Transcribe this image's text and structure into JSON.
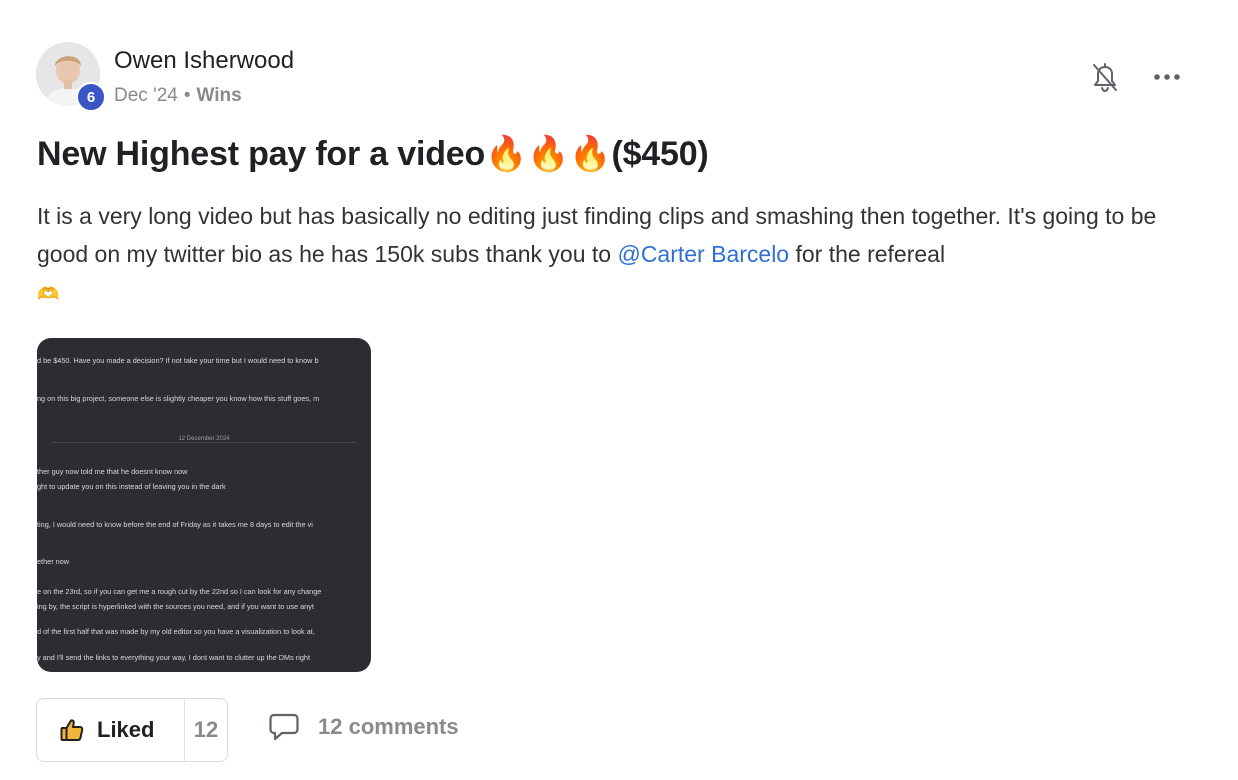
{
  "post": {
    "author": {
      "name": "Owen Isherwood",
      "level": "6"
    },
    "meta": {
      "date": "Dec '24",
      "separator": "•",
      "category": "Wins"
    },
    "title": "New Highest pay for a video🔥🔥🔥($450)",
    "body": {
      "text_before_mention": "It is a very long video but has basically no editing just finding clips and smashing then together. It's going to be good on my twitter bio as he has 150k subs thank you to ",
      "mention": "@Carter Barcelo",
      "text_after_mention": " for the refereal ",
      "emoji": "🫶"
    },
    "attachment": {
      "date_label": "12 December 2024",
      "lines": [
        "d be $450. Have you made a decision? If not take your time but I would need to know b",
        "ng on this big project, someone else is slightly cheaper you know how this stuff goes, m",
        "ther guy now told me that he doesnt know now",
        "ght to update you on this instead of leaving you in the dark",
        "ting, I would need to know before the end of Friday as it takes me 8 days to edit the vi",
        "ether now",
        "e on the 23rd, so if you can get me a rough cut by the 22nd so I can look for any change",
        "ing by, the script is hyperlinked with the sources you need, and if you want to use anyt",
        "d of the first half that was made by my old editor so you have a visualization to look at,",
        "y and I'll send the links to everything your way, I dont want to clutter up the DMs right"
      ]
    },
    "footer": {
      "like_label": "Liked",
      "like_count": "12",
      "comments_label": "12 comments"
    },
    "icons": {
      "bell": "bell-off-icon",
      "more": "more-horizontal-icon",
      "like": "thumbs-up-icon",
      "comment": "comment-icon"
    },
    "colors": {
      "mention": "#2f6fd6",
      "level_badge": "#3b55c4",
      "attachment_bg": "#2b2d31"
    }
  }
}
